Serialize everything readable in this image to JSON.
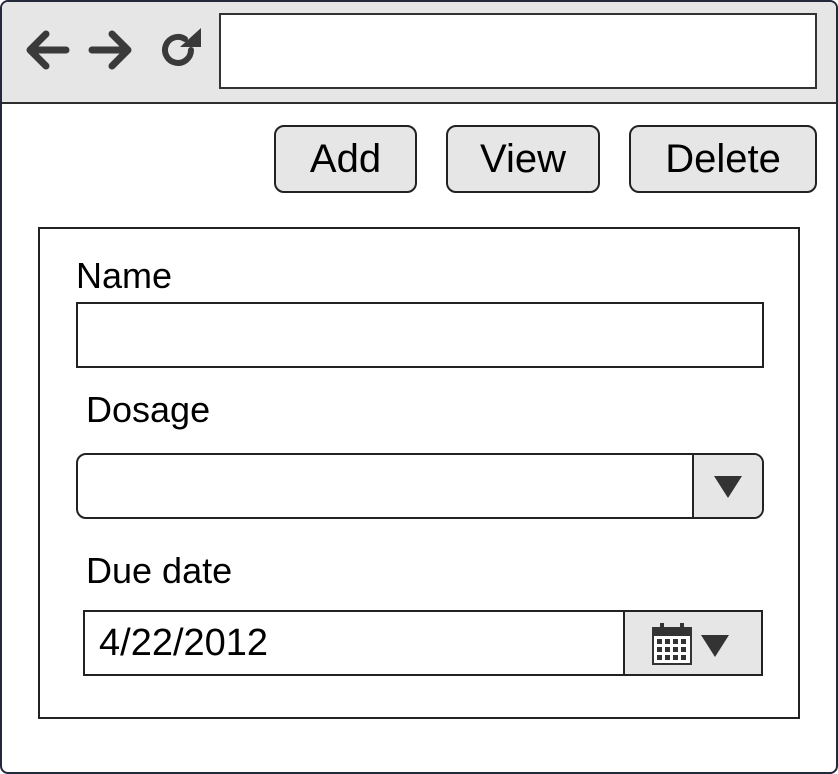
{
  "browser": {
    "address_value": "",
    "icons": [
      "back-arrow-icon",
      "forward-arrow-icon",
      "reload-icon"
    ]
  },
  "actions": {
    "add_label": "Add",
    "view_label": "View",
    "delete_label": "Delete"
  },
  "form": {
    "name_label": "Name",
    "name_value": "",
    "dosage_label": "Dosage",
    "dosage_value": "",
    "due_date_label": "Due date",
    "due_date_value": "4/22/2012"
  },
  "colors": {
    "chrome_gray": "#e6e6e6",
    "border": "#222222",
    "window_frame": "#23283a"
  }
}
